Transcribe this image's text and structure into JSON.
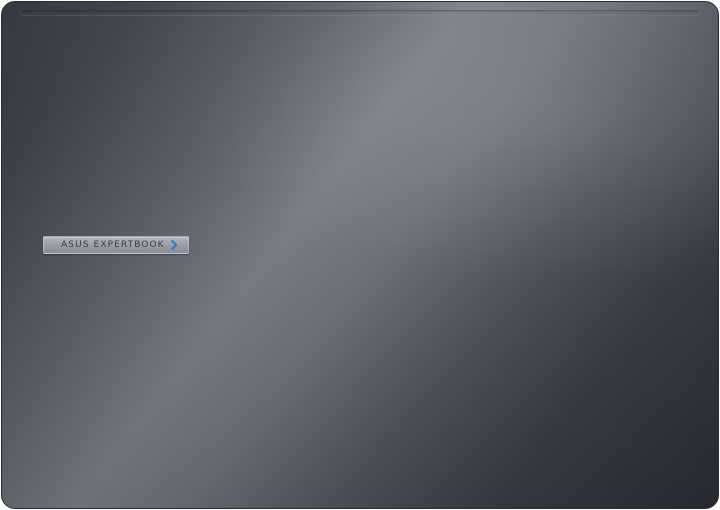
{
  "product": {
    "badge_text": "ASUS EXPERTBOOK",
    "chevron_color": "#2f7fcf"
  },
  "colors": {
    "lid_dark": "#2b2d34",
    "lid_mid": "#5e6169",
    "lid_highlight": "#7a7d86",
    "badge_silver": "#9ea2a9",
    "badge_text": "#3a3d44"
  }
}
